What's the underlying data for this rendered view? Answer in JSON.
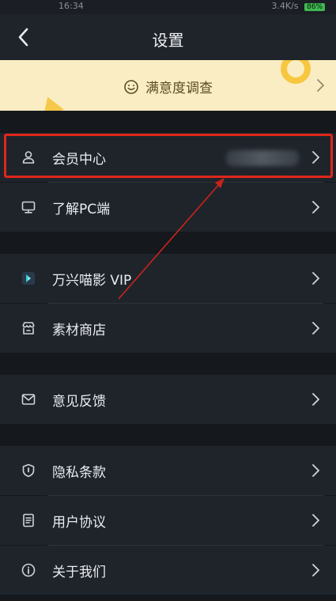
{
  "status_bar": {
    "time": "16:34",
    "network_speed": "3.4K/s",
    "battery": "86%"
  },
  "header": {
    "title": "设置",
    "back_icon": "chevron-left-icon"
  },
  "survey": {
    "label": "满意度调查",
    "icon": "smile-icon"
  },
  "settings_groups": [
    {
      "items": [
        {
          "label": "会员中心",
          "icon": "user-icon",
          "value": ""
        },
        {
          "label": "了解PC端",
          "icon": "monitor-icon"
        }
      ]
    },
    {
      "items": [
        {
          "label": "万兴喵影 VIP",
          "icon": "filmora-logo-icon"
        },
        {
          "label": "素材商店",
          "icon": "store-icon"
        }
      ]
    },
    {
      "items": [
        {
          "label": "意见反馈",
          "icon": "mail-icon"
        }
      ]
    },
    {
      "items": [
        {
          "label": "隐私条款",
          "icon": "shield-icon"
        },
        {
          "label": "用户协议",
          "icon": "document-icon"
        },
        {
          "label": "关于我们",
          "icon": "info-icon"
        }
      ]
    }
  ],
  "colors": {
    "background": "#15181d",
    "row_background": "#1f242b",
    "survey_background": "#fbedc3",
    "highlight_annotation": "#e0261b"
  }
}
